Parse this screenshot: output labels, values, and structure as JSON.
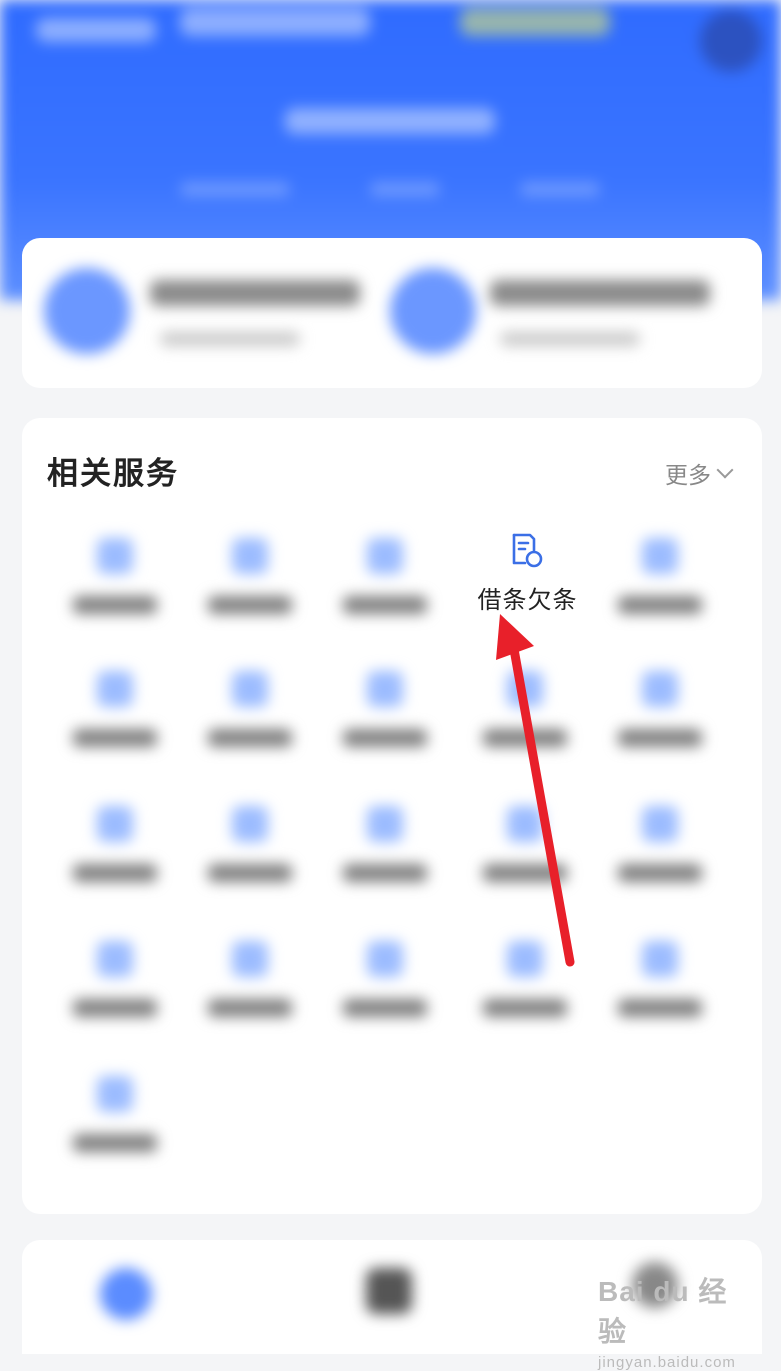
{
  "services": {
    "title": "相关服务",
    "more_label": "更多",
    "highlighted_item": {
      "label": "借条欠条",
      "icon": "document-icon"
    }
  },
  "annotation": {
    "arrow_color": "#e8202a"
  },
  "watermark": {
    "main": "Bai du 经验",
    "sub": "jingyan.baidu.com"
  }
}
